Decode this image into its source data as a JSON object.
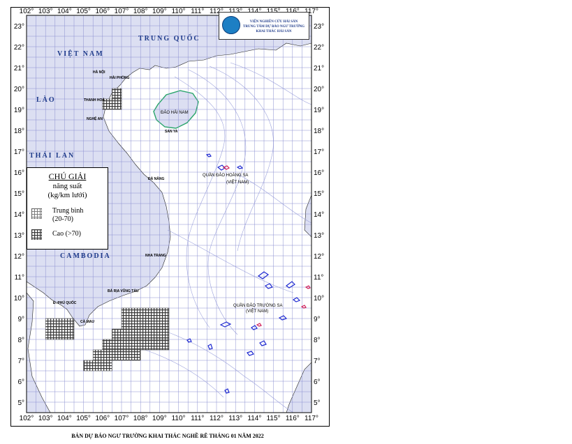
{
  "map": {
    "lon_ticks": [
      "102°",
      "103°",
      "104°",
      "105°",
      "106°",
      "107°",
      "108°",
      "109°",
      "110°",
      "111°",
      "112°",
      "113°",
      "114°",
      "115°",
      "116°",
      "117°"
    ],
    "lat_ticks": [
      "23°",
      "22°",
      "21°",
      "20°",
      "19°",
      "18°",
      "17°",
      "16°",
      "15°",
      "14°",
      "13°",
      "12°",
      "11°",
      "10°",
      "9°",
      "8°",
      "7°",
      "6°",
      "5°"
    ],
    "lon_range": [
      102,
      117
    ],
    "lat_range": [
      4.5,
      23.5
    ],
    "colors": {
      "land": "#dcdff2",
      "grid": "#8a8fd0",
      "contour": "#9aa0dc",
      "border": "#000000",
      "country_label": "#1e3a8a",
      "cell_high": "#555555",
      "cell_medium": "#9a9a9a",
      "patch_blue": "#1f2ad1",
      "patch_red": "#d11f5a"
    },
    "countries": [
      "VIỆT NAM",
      "TRUNG QUỐC",
      "LÀO",
      "THÁI LAN",
      "CAMBODIA"
    ],
    "places": [
      "HÀ NỘI",
      "HẢI PHÒNG",
      "THANH HOÁ",
      "NGHỆ AN",
      "ĐÀ NẴNG",
      "NHA TRANG",
      "BÀ RỊA VŨNG TÀU",
      "CÀ MAU",
      "Đ. PHÚ QUỐC",
      "SAN YA"
    ],
    "islands": [
      "ĐẢO HẢI NAM",
      "QUẦN ĐẢO HOÀNG SA",
      "(VIỆT NAM)",
      "QUẦN ĐẢO TRƯỜNG SA",
      "(VIỆT NAM)"
    ]
  },
  "fishing_cells": {
    "high": [
      {
        "lon": 106.5,
        "lat": 19.5,
        "w": 0.5,
        "h": 0.5
      },
      {
        "lon": 106,
        "lat": 19,
        "w": 1,
        "h": 0.5
      },
      {
        "lon": 103,
        "lat": 8,
        "w": 1.5,
        "h": 1
      },
      {
        "lon": 107,
        "lat": 8.5,
        "w": 2.5,
        "h": 1
      },
      {
        "lon": 106.5,
        "lat": 8,
        "w": 3,
        "h": 0.5
      },
      {
        "lon": 106,
        "lat": 7.5,
        "w": 3.5,
        "h": 0.5
      },
      {
        "lon": 105.5,
        "lat": 7,
        "w": 2.5,
        "h": 0.5
      },
      {
        "lon": 105,
        "lat": 6.5,
        "w": 1.5,
        "h": 0.5
      }
    ]
  },
  "logo": {
    "line1": "VIỆN NGHIÊN CỨU HẢI SẢN",
    "line2": "TRUNG TÂM DỰ BÁO NGƯ TRƯỜNG",
    "line3": "KHAI THÁC HẢI SẢN"
  },
  "legend": {
    "title": "CHÚ GIẢI",
    "subtitle1": "năng suất",
    "subtitle2": "(kg/km lưới)",
    "items": [
      {
        "label": "Trung bình",
        "range": "(20-70)"
      },
      {
        "label": "Cao (>70)"
      }
    ]
  },
  "caption": "BẢN DỰ BÁO NGƯ TRƯỜNG KHAI THÁC NGHỀ RÊ THÁNG 01 NĂM 2022"
}
